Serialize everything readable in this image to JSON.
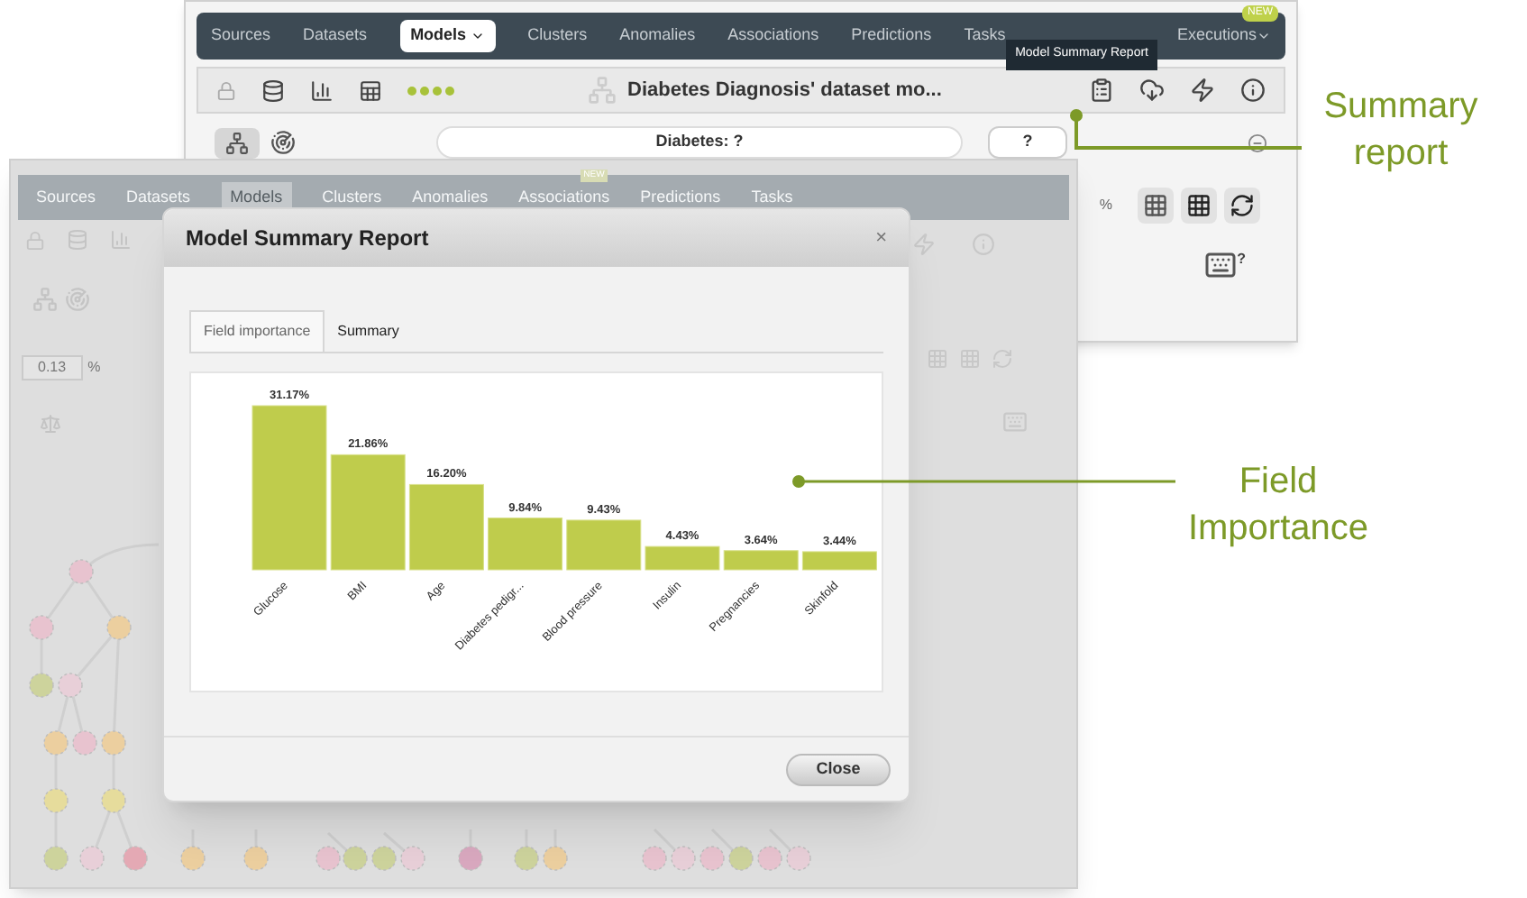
{
  "top_screen": {
    "nav": [
      {
        "label": "Sources",
        "selected": false,
        "dropdown": false
      },
      {
        "label": "Datasets",
        "selected": false,
        "dropdown": false
      },
      {
        "label": "Models",
        "selected": true,
        "dropdown": true
      },
      {
        "label": "Clusters",
        "selected": false,
        "dropdown": false
      },
      {
        "label": "Anomalies",
        "selected": false,
        "dropdown": false
      },
      {
        "label": "Associations",
        "selected": false,
        "dropdown": false
      },
      {
        "label": "Predictions",
        "selected": false,
        "dropdown": false
      },
      {
        "label": "Tasks",
        "selected": false,
        "dropdown": false
      }
    ],
    "executions": {
      "label": "Executions",
      "badge": "NEW"
    },
    "tooltip": "Model Summary Report",
    "title": "Diabetes Diagnosis' dataset mo...",
    "question": "Diabetes: ?",
    "answer": "?",
    "percent": "%",
    "help_mark": "?"
  },
  "back_screen": {
    "nav": [
      {
        "label": "Sources",
        "selected": false
      },
      {
        "label": "Datasets",
        "selected": false
      },
      {
        "label": "Models",
        "selected": true
      },
      {
        "label": "Clusters",
        "selected": false
      },
      {
        "label": "Anomalies",
        "selected": false
      },
      {
        "label": "Associations",
        "selected": false,
        "badge": "NEW"
      },
      {
        "label": "Predictions",
        "selected": false
      },
      {
        "label": "Tasks",
        "selected": false
      }
    ],
    "threshold": "0.13",
    "percent": "%"
  },
  "modal": {
    "title": "Model Summary Report",
    "close_mark": "×",
    "tabs": [
      {
        "label": "Field importance",
        "selected": true
      },
      {
        "label": "Summary",
        "selected": false
      }
    ],
    "chart_data": {
      "type": "bar",
      "categories": [
        "Glucose",
        "BMI",
        "Age",
        "Diabetes pedigr...",
        "Blood pressure",
        "Insulin",
        "Pregnancies",
        "Skinfold"
      ],
      "values": [
        31.17,
        21.86,
        16.2,
        9.84,
        9.43,
        4.43,
        3.64,
        3.44
      ],
      "value_labels": [
        "31.17%",
        "21.86%",
        "16.20%",
        "9.84%",
        "9.43%",
        "4.43%",
        "3.64%",
        "3.44%"
      ]
    },
    "close_button": "Close"
  },
  "callouts": [
    {
      "text": "Summary report"
    },
    {
      "text": "Field Importance"
    }
  ]
}
